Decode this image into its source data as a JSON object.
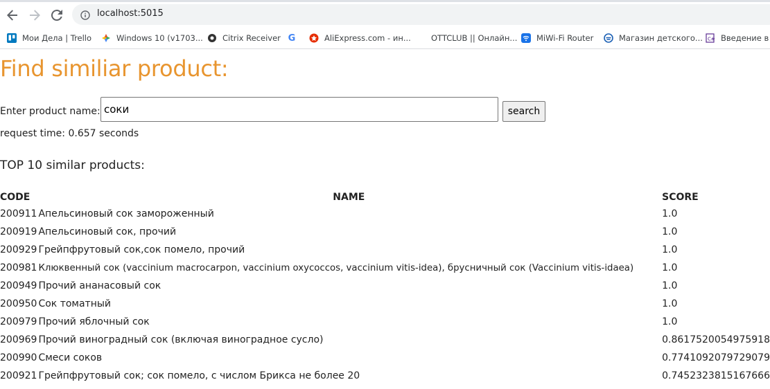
{
  "browser": {
    "url": "localhost:5015",
    "bookmarks": [
      {
        "label": "Мои Дела | Trello",
        "icon": "trello-icon",
        "color": "#0079bf"
      },
      {
        "label": "Windows 10 (v1703...",
        "icon": "windows-icon",
        "color": "#e34f26"
      },
      {
        "label": "Citrix Receiver",
        "icon": "citrix-icon",
        "color": "#333333"
      },
      {
        "label": "",
        "icon": "google-icon",
        "color": "#4285f4"
      },
      {
        "label": "AliExpress.com - ин...",
        "icon": "aliexpress-icon",
        "color": "#e62e04"
      },
      {
        "label": "OTTCLUB || Онлайн...",
        "icon": "ottclub-icon",
        "color": "#ffffff"
      },
      {
        "label": "MiWi-Fi Router",
        "icon": "wifi-icon",
        "color": "#1a73e8"
      },
      {
        "label": "Магазин детского...",
        "icon": "shop-icon",
        "color": "#1a5fb4"
      },
      {
        "label": "Введение в V",
        "icon": "csharp-icon",
        "color": "#5c2d91"
      }
    ]
  },
  "page": {
    "title": "Find similiar product:",
    "title_color": "#e8952f",
    "input_label": "Enter product name:",
    "input_value": "соки",
    "search_label": "search",
    "request_time": "request time: 0.657 seconds",
    "results_heading": "TOP 10 similar products:",
    "table": {
      "headers": [
        "CODE",
        "NAME",
        "SCORE"
      ],
      "rows": [
        {
          "code": "200911",
          "name": "Апельсиновый сок замороженный",
          "score": "1.0"
        },
        {
          "code": "200919",
          "name": "Апельсиновый сок, прочий",
          "score": "1.0"
        },
        {
          "code": "200929",
          "name": "Грейпфрутовый сок,сок помело, прочий",
          "score": "1.0"
        },
        {
          "code": "200981",
          "name": "Клюквенный сок (vaccinium macrocarpon, vaccinium oxycoccos, vaccinium vitis-idea), брусничный сок (Vaccinium vitis-idaea)",
          "score": "1.0"
        },
        {
          "code": "200949",
          "name": "Прочий ананасовый сок",
          "score": "1.0"
        },
        {
          "code": "200950",
          "name": "Сок томатный",
          "score": "1.0"
        },
        {
          "code": "200979",
          "name": "Прочий яблочный сок",
          "score": "1.0"
        },
        {
          "code": "200969",
          "name": "Прочий виноградный сок (включая виноградное сусло)",
          "score": "0.8617520054975918"
        },
        {
          "code": "200990",
          "name": "Смеси соков",
          "score": "0.7741092079729079"
        },
        {
          "code": "200921",
          "name": "Грейпфрутовый сок; сок помело, с числом Брикса не более 20",
          "score": "0.7452323815167666"
        }
      ]
    }
  }
}
